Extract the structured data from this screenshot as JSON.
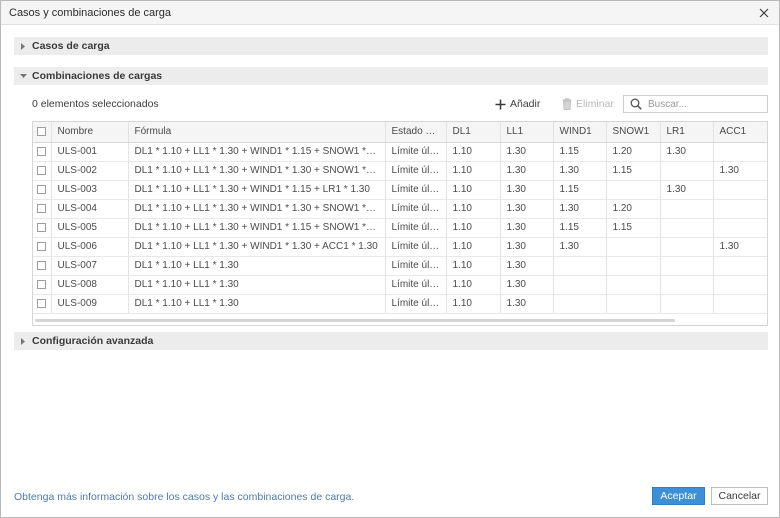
{
  "window": {
    "title": "Casos y combinaciones de carga"
  },
  "sections": {
    "load_cases": {
      "label": "Casos de carga",
      "expanded": false
    },
    "combinations": {
      "label": "Combinaciones de cargas",
      "expanded": true
    },
    "advanced": {
      "label": "Configuración avanzada",
      "expanded": false
    }
  },
  "toolbar": {
    "selection_count": "0 elementos seleccionados",
    "add_label": "Añadir",
    "delete_label": "Eliminar",
    "search_placeholder": "Buscar..."
  },
  "table": {
    "columns": [
      "Nombre",
      "Fórmula",
      "Estado D...",
      "DL1",
      "LL1",
      "WIND1",
      "SNOW1",
      "LR1",
      "ACC1"
    ],
    "rows": [
      [
        "ULS-001",
        "DL1 * 1.10 + LL1 * 1.30 + WIND1 * 1.15 + SNOW1 * 1.20 + L...",
        "Límite últ...",
        "1.10",
        "1.30",
        "1.15",
        "1.20",
        "1.30",
        ""
      ],
      [
        "ULS-002",
        "DL1 * 1.10 + LL1 * 1.30 + WIND1 * 1.30 + SNOW1 * 1.15 + A...",
        "Límite últ...",
        "1.10",
        "1.30",
        "1.30",
        "1.15",
        "",
        "1.30"
      ],
      [
        "ULS-003",
        "DL1 * 1.10 + LL1 * 1.30 + WIND1 * 1.15 + LR1 * 1.30",
        "Límite últ...",
        "1.10",
        "1.30",
        "1.15",
        "",
        "1.30",
        ""
      ],
      [
        "ULS-004",
        "DL1 * 1.10 + LL1 * 1.30 + WIND1 * 1.30 + SNOW1 * 1.20",
        "Límite últ...",
        "1.10",
        "1.30",
        "1.30",
        "1.20",
        "",
        ""
      ],
      [
        "ULS-005",
        "DL1 * 1.10 + LL1 * 1.30 + WIND1 * 1.15 + SNOW1 * 1.15",
        "Límite últ...",
        "1.10",
        "1.30",
        "1.15",
        "1.15",
        "",
        ""
      ],
      [
        "ULS-006",
        "DL1 * 1.10 + LL1 * 1.30 + WIND1 * 1.30 + ACC1 * 1.30",
        "Límite últ...",
        "1.10",
        "1.30",
        "1.30",
        "",
        "",
        "1.30"
      ],
      [
        "ULS-007",
        "DL1 * 1.10 + LL1 * 1.30",
        "Límite últ...",
        "1.10",
        "1.30",
        "",
        "",
        "",
        ""
      ],
      [
        "ULS-008",
        "DL1 * 1.10 + LL1 * 1.30",
        "Límite últ...",
        "1.10",
        "1.30",
        "",
        "",
        "",
        ""
      ],
      [
        "ULS-009",
        "DL1 * 1.10 + LL1 * 1.30",
        "Límite últ...",
        "1.10",
        "1.30",
        "",
        "",
        "",
        ""
      ]
    ]
  },
  "footer": {
    "help_link": "Obtenga más información sobre los casos y las combinaciones de carga.",
    "accept_label": "Aceptar",
    "cancel_label": "Cancelar"
  },
  "colors": {
    "accent": "#3d8fd8",
    "link": "#4a7cb0",
    "section_bg": "#ececec"
  },
  "icons": {
    "close": "close-icon",
    "add": "plus-icon",
    "delete": "trash-icon",
    "search": "search-icon"
  }
}
